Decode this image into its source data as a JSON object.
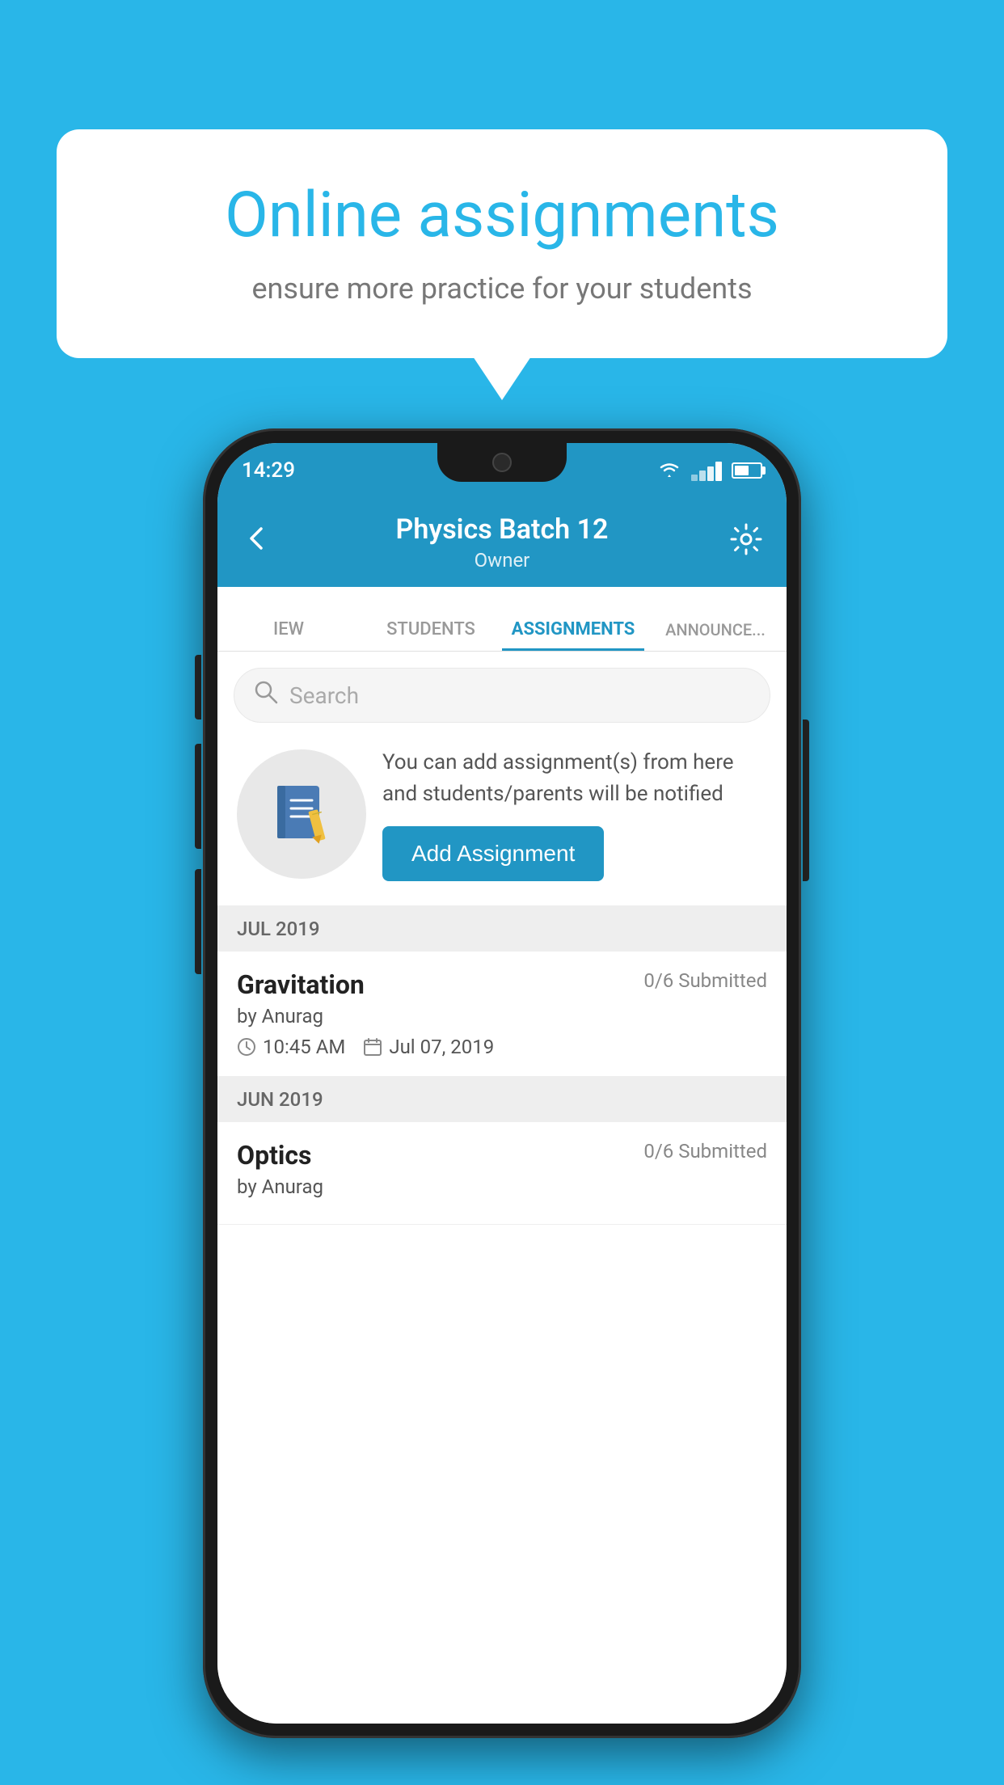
{
  "background_color": "#29b6e8",
  "speech_bubble": {
    "title": "Online assignments",
    "subtitle": "ensure more practice for your students"
  },
  "status_bar": {
    "time": "14:29"
  },
  "header": {
    "title": "Physics Batch 12",
    "subtitle": "Owner",
    "back_label": "←",
    "settings_label": "⚙"
  },
  "tabs": [
    {
      "label": "IEW",
      "active": false
    },
    {
      "label": "STUDENTS",
      "active": false
    },
    {
      "label": "ASSIGNMENTS",
      "active": true
    },
    {
      "label": "ANNOUNCEI...",
      "active": false
    }
  ],
  "search": {
    "placeholder": "Search"
  },
  "promo": {
    "description": "You can add assignment(s) from here and students/parents will be notified",
    "button_label": "Add Assignment"
  },
  "assignments": [
    {
      "section": "JUL 2019",
      "items": [
        {
          "name": "Gravitation",
          "submitted": "0/6 Submitted",
          "by": "by Anurag",
          "time": "10:45 AM",
          "date": "Jul 07, 2019"
        }
      ]
    },
    {
      "section": "JUN 2019",
      "items": [
        {
          "name": "Optics",
          "submitted": "0/6 Submitted",
          "by": "by Anurag",
          "time": "",
          "date": ""
        }
      ]
    }
  ]
}
